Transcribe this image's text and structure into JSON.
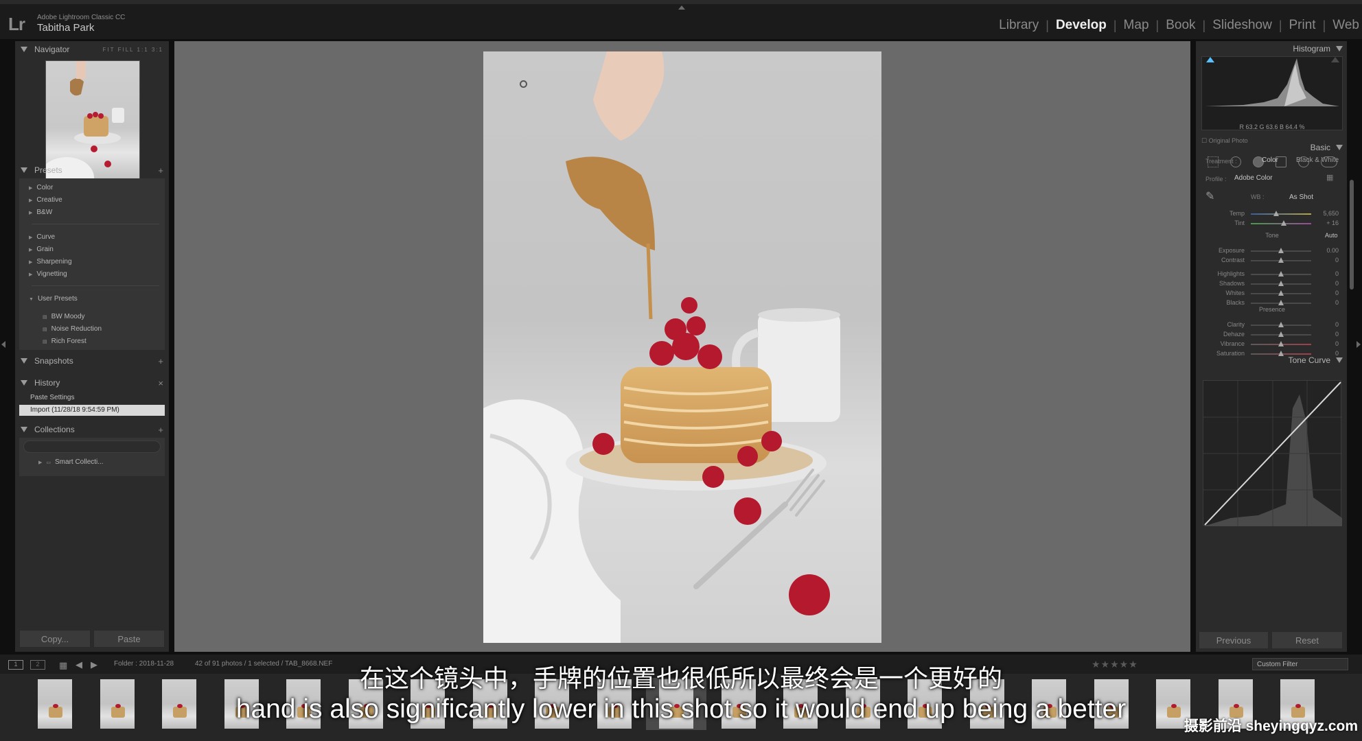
{
  "app": {
    "logo": "Lr",
    "product": "Adobe Lightroom Classic CC",
    "user": "Tabitha Park"
  },
  "modules": [
    "Library",
    "Develop",
    "Map",
    "Book",
    "Slideshow",
    "Print",
    "Web"
  ],
  "active_module": "Develop",
  "left_panel": {
    "navigator": {
      "title": "Navigator",
      "zoom_options": "FIT  FILL  1:1  3:1"
    },
    "presets": {
      "title": "Presets",
      "items": [
        "Color",
        "Creative",
        "B&W",
        "Curve",
        "Grain",
        "Sharpening",
        "Vignetting",
        "User Presets"
      ],
      "user_presets": [
        "BW Moody",
        "Noise Reduction",
        "Rich Forest"
      ]
    },
    "snapshots": {
      "title": "Snapshots"
    },
    "history": {
      "title": "History",
      "items": [
        "Paste Settings",
        "Import (11/28/18 9:54:59 PM)"
      ]
    },
    "collections": {
      "title": "Collections",
      "items": [
        "Smart Collecti..."
      ]
    },
    "copy_label": "Copy...",
    "paste_label": "Paste"
  },
  "right_panel": {
    "histogram": {
      "title": "Histogram",
      "r": "63.2",
      "g": "63.6",
      "b": "64.4",
      "readout": "R  63.2   G  63.6   B  64.4 %",
      "original_photo": "Original Photo"
    },
    "basic": {
      "title": "Basic",
      "treatment_label": "Treatment :",
      "treatment_color": "Color",
      "treatment_bw": "Black & White",
      "profile_label": "Profile :",
      "profile_value": "Adobe Color",
      "wb_label": "WB :",
      "wb_value": "As Shot",
      "tone_label": "Tone",
      "auto_label": "Auto",
      "presence_label": "Presence",
      "sliders": [
        {
          "label": "Temp",
          "value": "5,650",
          "pos": 0.42
        },
        {
          "label": "Tint",
          "value": "+ 16",
          "pos": 0.55
        },
        {
          "label": "Exposure",
          "value": "0.00",
          "pos": 0.5
        },
        {
          "label": "Contrast",
          "value": "0",
          "pos": 0.5
        },
        {
          "label": "Highlights",
          "value": "0",
          "pos": 0.5
        },
        {
          "label": "Shadows",
          "value": "0",
          "pos": 0.5
        },
        {
          "label": "Whites",
          "value": "0",
          "pos": 0.5
        },
        {
          "label": "Blacks",
          "value": "0",
          "pos": 0.5
        },
        {
          "label": "Clarity",
          "value": "0",
          "pos": 0.5
        },
        {
          "label": "Dehaze",
          "value": "0",
          "pos": 0.5
        },
        {
          "label": "Vibrance",
          "value": "0",
          "pos": 0.5
        },
        {
          "label": "Saturation",
          "value": "0",
          "pos": 0.5
        }
      ]
    },
    "tone_curve": {
      "title": "Tone Curve"
    },
    "previous_label": "Previous",
    "reset_label": "Reset"
  },
  "filmstrip": {
    "folder": "Folder : 2018-11-28",
    "count": "42 of 91 photos / 1 selected / TAB_8668.NEF",
    "filter": "Custom Filter",
    "thumb_count": 21
  },
  "subtitles": {
    "chinese": "在这个镜头中，手牌的位置也很低所以最终会是一个更好的",
    "english": "hand is also significantly lower in this shot so it would end up being a better"
  },
  "watermark": "摄影前沿 sheyingqyz.com"
}
